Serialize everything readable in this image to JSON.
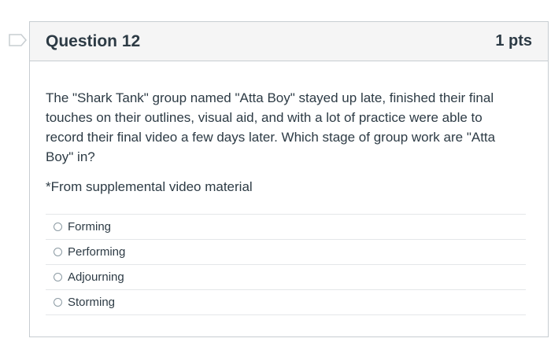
{
  "question": {
    "title": "Question 12",
    "points": "1 pts",
    "text": "The \"Shark Tank\" group named \"Atta Boy\" stayed up late, finished their final touches on their outlines, visual aid, and with a lot of practice were able to record their final video a few days later. Which stage of group work are \"Atta Boy\" in?",
    "note": "*From supplemental video material",
    "answers": [
      {
        "label": "Forming"
      },
      {
        "label": "Performing"
      },
      {
        "label": "Adjourning"
      },
      {
        "label": "Storming"
      }
    ]
  },
  "colors": {
    "text": "#2d3b45",
    "header_bg": "#f5f5f5",
    "border": "#c7cdd1",
    "flag": "#c7cdd1"
  },
  "icons": {
    "flag": "bookmark-flag-icon",
    "radio": "radio-button-icon"
  }
}
